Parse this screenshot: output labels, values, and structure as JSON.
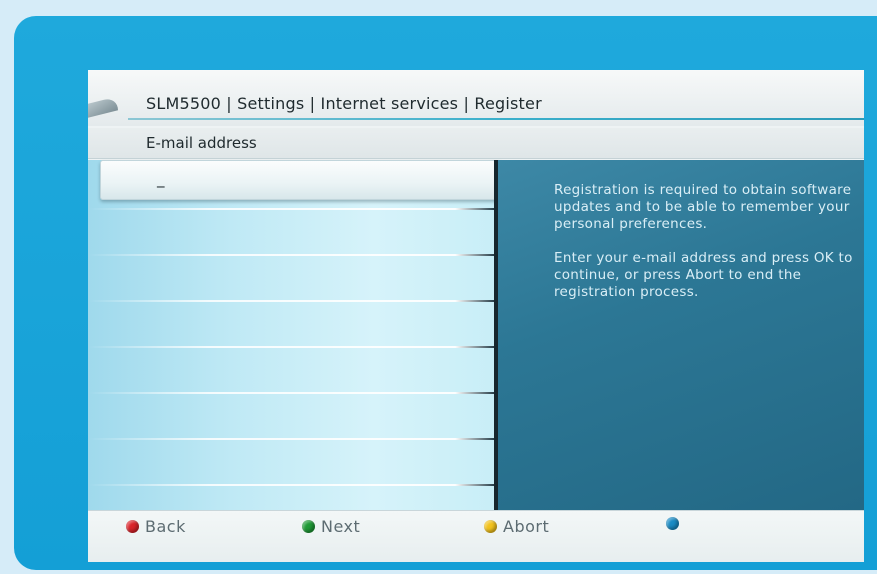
{
  "header": {
    "breadcrumb": "SLM5500 | Settings | Internet services | Register"
  },
  "field": {
    "label": "E-mail address",
    "value": "_"
  },
  "help": {
    "paragraph_1": "Registration is required to obtain software updates and to be able to remember your personal preferences.",
    "paragraph_2": "Enter your e-mail address and press OK to continue, or press Abort to end the registration process."
  },
  "keys": [
    {
      "label": "Back",
      "color": "#d9232a",
      "icon": "red-button-icon"
    },
    {
      "label": "Next",
      "color": "#1f9a36",
      "icon": "green-button-icon"
    },
    {
      "label": "Abort",
      "color": "#f2c21c",
      "icon": "yellow-button-icon"
    },
    {
      "label": "",
      "color": "#1a8bc4",
      "icon": "blue-button-icon"
    }
  ],
  "colors": {
    "frame": "#1fa9dc",
    "help_panel": "#2c7795",
    "list_panel": "#bfe9f5"
  }
}
